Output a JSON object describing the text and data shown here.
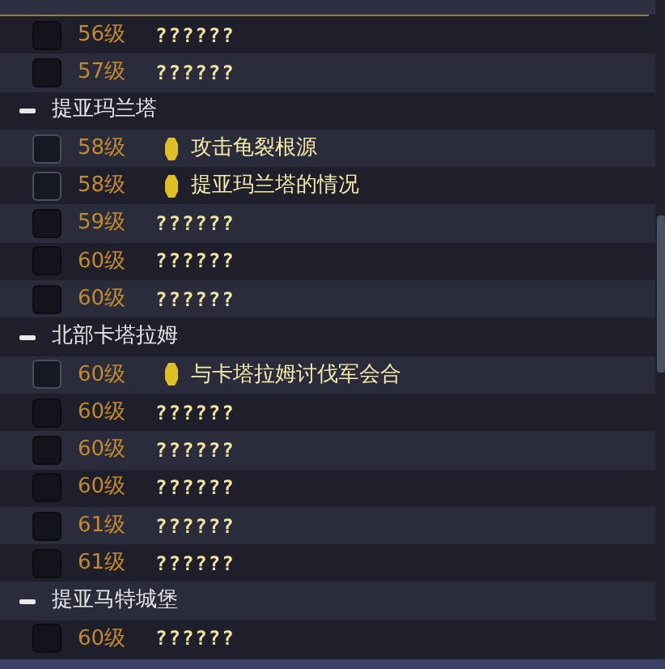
{
  "groups": [
    {
      "quests": [
        {
          "level": "56级",
          "title": "??????",
          "kind": "unknown"
        },
        {
          "level": "57级",
          "title": "??????",
          "kind": "unknown"
        }
      ]
    },
    {
      "name": "提亚玛兰塔",
      "expanded": true,
      "quests": [
        {
          "level": "58级",
          "title": "攻击龟裂根源",
          "kind": "quest"
        },
        {
          "level": "58级",
          "title": "提亚玛兰塔的情况",
          "kind": "quest"
        },
        {
          "level": "59级",
          "title": "??????",
          "kind": "unknown"
        },
        {
          "level": "60级",
          "title": "??????",
          "kind": "unknown"
        },
        {
          "level": "60级",
          "title": "??????",
          "kind": "unknown"
        }
      ]
    },
    {
      "name": "北部卡塔拉姆",
      "expanded": true,
      "quests": [
        {
          "level": "60级",
          "title": "与卡塔拉姆讨伐军会合",
          "kind": "quest"
        },
        {
          "level": "60级",
          "title": "??????",
          "kind": "unknown"
        },
        {
          "level": "60级",
          "title": "??????",
          "kind": "unknown"
        },
        {
          "level": "60级",
          "title": "??????",
          "kind": "unknown"
        },
        {
          "level": "61级",
          "title": "??????",
          "kind": "unknown"
        },
        {
          "level": "61级",
          "title": "??????",
          "kind": "unknown"
        }
      ]
    },
    {
      "name": "提亚马特城堡",
      "expanded": true,
      "quests": [
        {
          "level": "60级",
          "title": "??????",
          "kind": "unknown"
        }
      ]
    }
  ]
}
